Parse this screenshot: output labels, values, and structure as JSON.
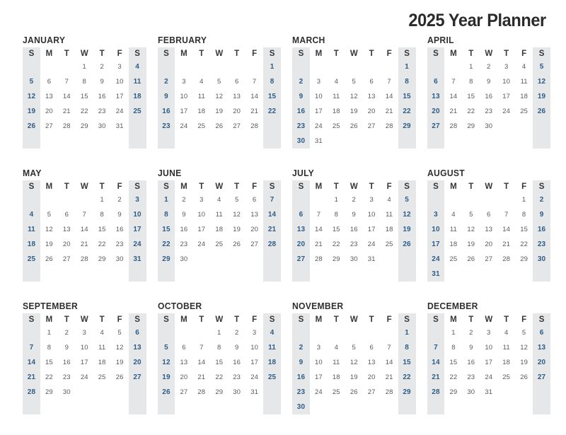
{
  "header": {
    "title": "2025 Year Planner"
  },
  "weekday_headers": [
    "S",
    "M",
    "T",
    "W",
    "T",
    "F",
    "S"
  ],
  "colors": {
    "weekend_band": "#e6e7e9",
    "weekend_band_light": "#f1f2f4",
    "weekend_text": "#2d5d86",
    "weekday_text": "#5a5a5e",
    "title_text": "#2b2b2d",
    "month_name_text": "#2f2f31",
    "page_background": "#ffffff"
  },
  "weekend_columns": [
    0,
    6
  ],
  "year": "2025",
  "months": [
    {
      "name": "JANUARY",
      "start_day_index": 3,
      "num_days": 31,
      "weeks": [
        [
          "",
          "",
          "",
          "1",
          "2",
          "3",
          "4"
        ],
        [
          "5",
          "6",
          "7",
          "8",
          "9",
          "10",
          "11"
        ],
        [
          "12",
          "13",
          "14",
          "15",
          "16",
          "17",
          "18"
        ],
        [
          "19",
          "20",
          "21",
          "22",
          "23",
          "24",
          "25"
        ],
        [
          "26",
          "27",
          "28",
          "29",
          "30",
          "31",
          ""
        ],
        [
          "",
          "",
          "",
          "",
          "",
          "",
          ""
        ]
      ]
    },
    {
      "name": "FEBRUARY",
      "start_day_index": 6,
      "num_days": 28,
      "weeks": [
        [
          "",
          "",
          "",
          "",
          "",
          "",
          "1"
        ],
        [
          "2",
          "3",
          "4",
          "5",
          "6",
          "7",
          "8"
        ],
        [
          "9",
          "10",
          "11",
          "12",
          "13",
          "14",
          "15"
        ],
        [
          "16",
          "17",
          "18",
          "19",
          "20",
          "21",
          "22"
        ],
        [
          "23",
          "24",
          "25",
          "26",
          "27",
          "28",
          ""
        ],
        [
          "",
          "",
          "",
          "",
          "",
          "",
          ""
        ]
      ]
    },
    {
      "name": "MARCH",
      "start_day_index": 6,
      "num_days": 31,
      "weeks": [
        [
          "",
          "",
          "",
          "",
          "",
          "",
          "1"
        ],
        [
          "2",
          "3",
          "4",
          "5",
          "6",
          "7",
          "8"
        ],
        [
          "9",
          "10",
          "11",
          "12",
          "13",
          "14",
          "15"
        ],
        [
          "16",
          "17",
          "18",
          "19",
          "20",
          "21",
          "22"
        ],
        [
          "23",
          "24",
          "25",
          "26",
          "27",
          "28",
          "29"
        ],
        [
          "30",
          "31",
          "",
          "",
          "",
          "",
          ""
        ]
      ]
    },
    {
      "name": "APRIL",
      "start_day_index": 2,
      "num_days": 30,
      "weeks": [
        [
          "",
          "",
          "1",
          "2",
          "3",
          "4",
          "5"
        ],
        [
          "6",
          "7",
          "8",
          "9",
          "10",
          "11",
          "12"
        ],
        [
          "13",
          "14",
          "15",
          "16",
          "17",
          "18",
          "19"
        ],
        [
          "20",
          "21",
          "22",
          "23",
          "24",
          "25",
          "26"
        ],
        [
          "27",
          "28",
          "29",
          "30",
          "",
          "",
          ""
        ],
        [
          "",
          "",
          "",
          "",
          "",
          "",
          ""
        ]
      ]
    },
    {
      "name": "MAY",
      "start_day_index": 4,
      "num_days": 31,
      "weeks": [
        [
          "",
          "",
          "",
          "",
          "1",
          "2",
          "3"
        ],
        [
          "4",
          "5",
          "6",
          "7",
          "8",
          "9",
          "10"
        ],
        [
          "11",
          "12",
          "13",
          "14",
          "15",
          "16",
          "17"
        ],
        [
          "18",
          "19",
          "20",
          "21",
          "22",
          "23",
          "24"
        ],
        [
          "25",
          "26",
          "27",
          "28",
          "29",
          "30",
          "31"
        ],
        [
          "",
          "",
          "",
          "",
          "",
          "",
          ""
        ]
      ]
    },
    {
      "name": "JUNE",
      "start_day_index": 0,
      "num_days": 30,
      "weeks": [
        [
          "1",
          "2",
          "3",
          "4",
          "5",
          "6",
          "7"
        ],
        [
          "8",
          "9",
          "10",
          "11",
          "12",
          "13",
          "14"
        ],
        [
          "15",
          "16",
          "17",
          "18",
          "19",
          "20",
          "21"
        ],
        [
          "22",
          "23",
          "24",
          "25",
          "26",
          "27",
          "28"
        ],
        [
          "29",
          "30",
          "",
          "",
          "",
          "",
          ""
        ],
        [
          "",
          "",
          "",
          "",
          "",
          "",
          ""
        ]
      ]
    },
    {
      "name": "JULY",
      "start_day_index": 2,
      "num_days": 31,
      "weeks": [
        [
          "",
          "",
          "1",
          "2",
          "3",
          "4",
          "5"
        ],
        [
          "6",
          "7",
          "8",
          "9",
          "10",
          "11",
          "12"
        ],
        [
          "13",
          "14",
          "15",
          "16",
          "17",
          "18",
          "19"
        ],
        [
          "20",
          "21",
          "22",
          "23",
          "24",
          "25",
          "26"
        ],
        [
          "27",
          "28",
          "29",
          "30",
          "31",
          "",
          ""
        ],
        [
          "",
          "",
          "",
          "",
          "",
          "",
          ""
        ]
      ]
    },
    {
      "name": "AUGUST",
      "start_day_index": 5,
      "num_days": 31,
      "weeks": [
        [
          "",
          "",
          "",
          "",
          "",
          "1",
          "2"
        ],
        [
          "3",
          "4",
          "5",
          "6",
          "7",
          "8",
          "9"
        ],
        [
          "10",
          "11",
          "12",
          "13",
          "14",
          "15",
          "16"
        ],
        [
          "17",
          "18",
          "19",
          "20",
          "21",
          "22",
          "23"
        ],
        [
          "24",
          "25",
          "26",
          "27",
          "28",
          "29",
          "30"
        ],
        [
          "31",
          "",
          "",
          "",
          "",
          "",
          ""
        ]
      ]
    },
    {
      "name": "SEPTEMBER",
      "start_day_index": 1,
      "num_days": 30,
      "weeks": [
        [
          "",
          "1",
          "2",
          "3",
          "4",
          "5",
          "6"
        ],
        [
          "7",
          "8",
          "9",
          "10",
          "11",
          "12",
          "13"
        ],
        [
          "14",
          "15",
          "16",
          "17",
          "18",
          "19",
          "20"
        ],
        [
          "21",
          "22",
          "23",
          "24",
          "25",
          "26",
          "27"
        ],
        [
          "28",
          "29",
          "30",
          "",
          "",
          "",
          ""
        ],
        [
          "",
          "",
          "",
          "",
          "",
          "",
          ""
        ]
      ]
    },
    {
      "name": "OCTOBER",
      "start_day_index": 3,
      "num_days": 31,
      "weeks": [
        [
          "",
          "",
          "",
          "1",
          "2",
          "3",
          "4"
        ],
        [
          "5",
          "6",
          "7",
          "8",
          "9",
          "10",
          "11"
        ],
        [
          "12",
          "13",
          "14",
          "15",
          "16",
          "17",
          "18"
        ],
        [
          "19",
          "20",
          "21",
          "22",
          "23",
          "24",
          "25"
        ],
        [
          "26",
          "27",
          "28",
          "29",
          "30",
          "31",
          ""
        ],
        [
          "",
          "",
          "",
          "",
          "",
          "",
          ""
        ]
      ]
    },
    {
      "name": "NOVEMBER",
      "start_day_index": 6,
      "num_days": 30,
      "weeks": [
        [
          "",
          "",
          "",
          "",
          "",
          "",
          "1"
        ],
        [
          "2",
          "3",
          "4",
          "5",
          "6",
          "7",
          "8"
        ],
        [
          "9",
          "10",
          "11",
          "12",
          "13",
          "14",
          "15"
        ],
        [
          "16",
          "17",
          "18",
          "19",
          "20",
          "21",
          "22"
        ],
        [
          "23",
          "24",
          "25",
          "26",
          "27",
          "28",
          "29"
        ],
        [
          "30",
          "",
          "",
          "",
          "",
          "",
          ""
        ]
      ]
    },
    {
      "name": "DECEMBER",
      "start_day_index": 1,
      "num_days": 31,
      "weeks": [
        [
          "",
          "1",
          "2",
          "3",
          "4",
          "5",
          "6"
        ],
        [
          "7",
          "8",
          "9",
          "10",
          "11",
          "12",
          "13"
        ],
        [
          "14",
          "15",
          "16",
          "17",
          "18",
          "19",
          "20"
        ],
        [
          "21",
          "22",
          "23",
          "24",
          "25",
          "26",
          "27"
        ],
        [
          "28",
          "29",
          "30",
          "31",
          "",
          "",
          ""
        ],
        [
          "",
          "",
          "",
          "",
          "",
          "",
          ""
        ]
      ]
    }
  ]
}
